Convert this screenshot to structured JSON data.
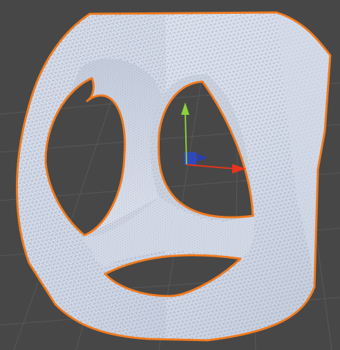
{
  "scene_view": {
    "background_color": "#474747",
    "grid_color": "#5a5a5a",
    "selected_object": {
      "shape": "rounded-cube-with-three-elliptic-cutouts",
      "render_mode": "shaded-wireframe",
      "surface_color": "#dfe5ef",
      "wire_color": "#8e9ab5",
      "selection_outline_color": "#f07a1e"
    },
    "transform_gizmo": {
      "x_axis_color": "#e8341c",
      "y_axis_color": "#8ad23a",
      "z_axis_color": "#2e48c8",
      "handle": "arrow"
    }
  }
}
